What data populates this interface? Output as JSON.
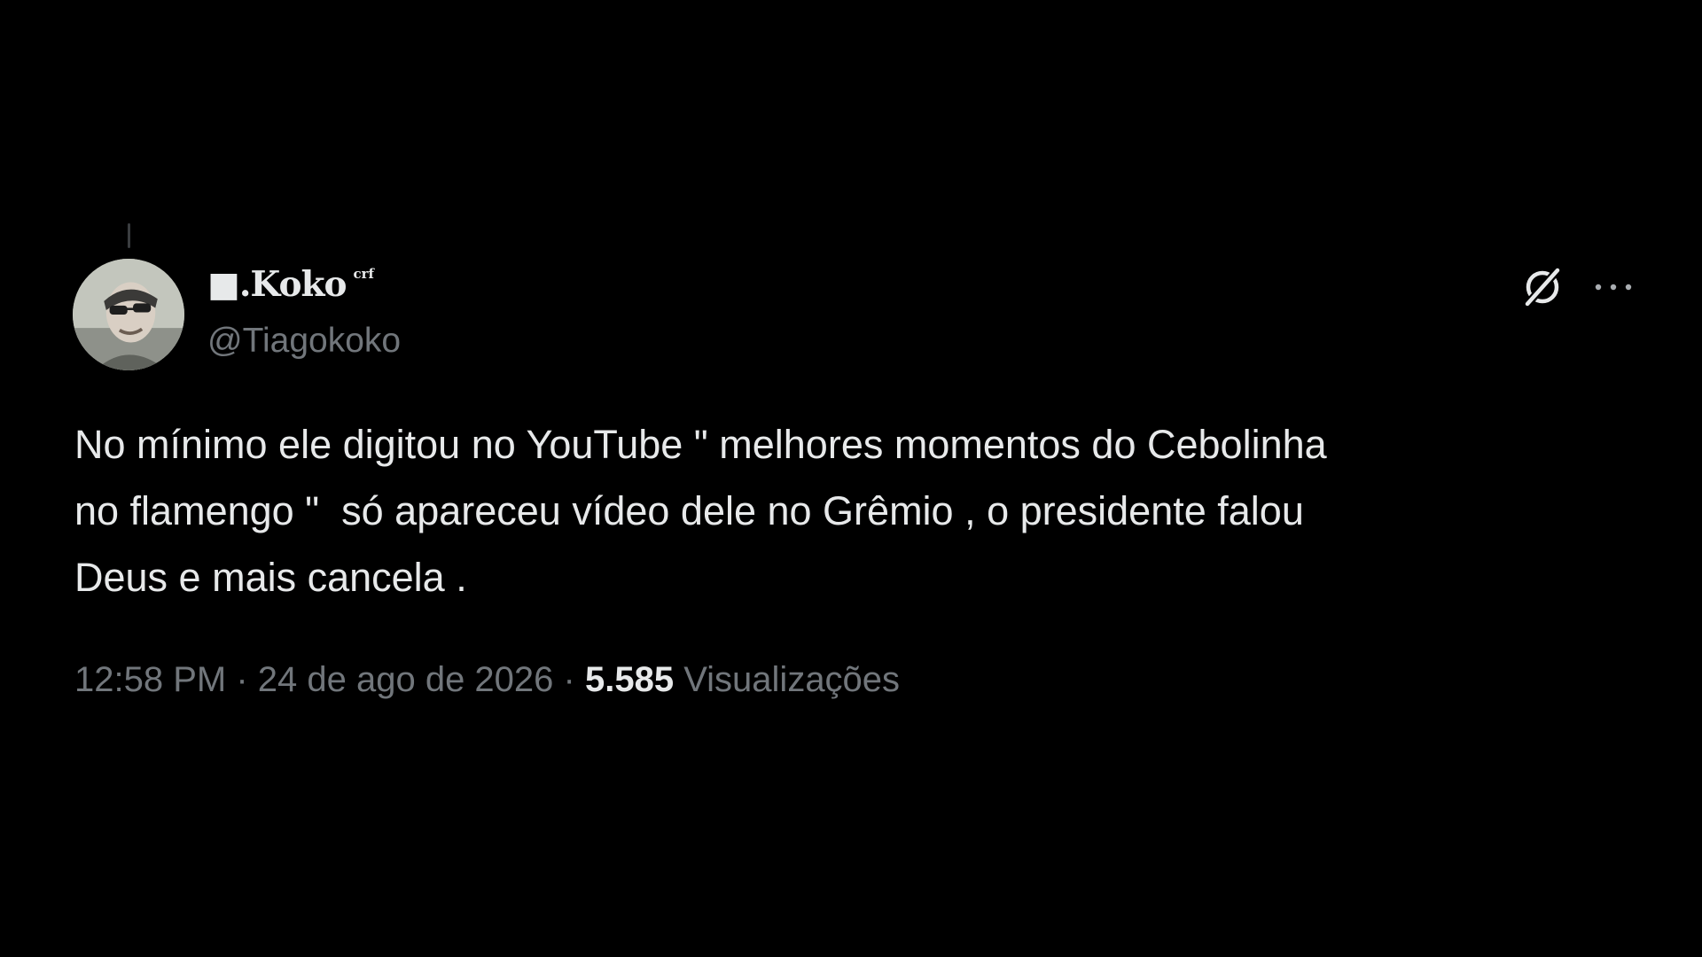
{
  "author": {
    "display_name": "■.Koko",
    "name_suffix": "crf",
    "handle": "@Tiagokoko"
  },
  "tweet": {
    "text_lines": [
      "No mínimo ele digitou no YouTube \" melhores momentos do Cebolinha",
      "no flamengo \"  só apareceu vídeo dele no Grêmio , o presidente falou",
      "Deus e mais cancela ."
    ]
  },
  "meta": {
    "time": "12:58 PM",
    "separator": " · ",
    "date": "24 de ago de 2026",
    "views_count": "5.585",
    "views_label": "Visualizações"
  },
  "icons": {
    "grok": "grok-icon",
    "more": "more-horizontal-icon"
  },
  "colors": {
    "background": "#000000",
    "primary_text": "#e7e9ea",
    "secondary_text": "#71767b"
  }
}
